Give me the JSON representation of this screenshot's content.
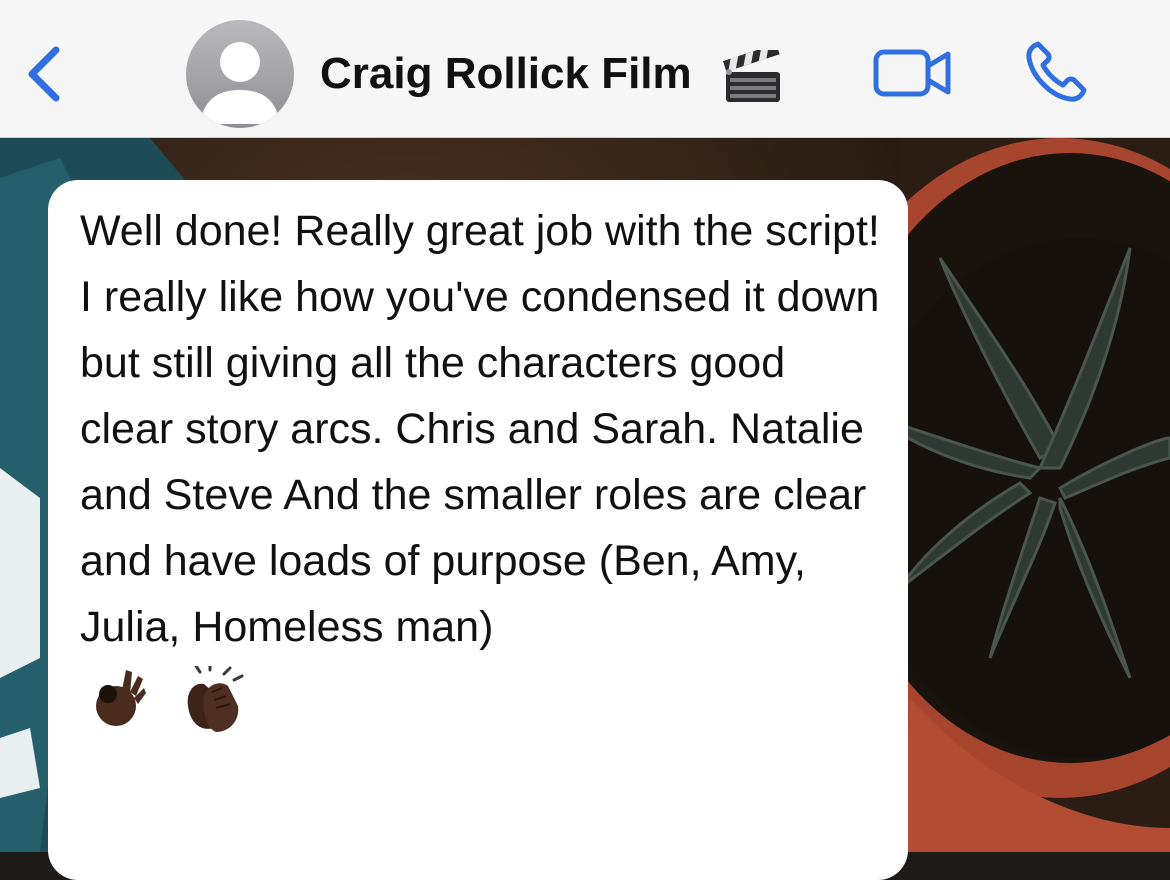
{
  "header": {
    "contact_name": "Craig Rollick Film",
    "back_icon": "chevron-left-icon",
    "avatar_icon": "person-silhouette-icon",
    "name_emoji": "clapper-board-icon",
    "video_icon": "video-camera-icon",
    "call_icon": "phone-icon"
  },
  "message": {
    "text": "Well done! Really great job with the script! I really like how you've condensed it down but still giving all the characters good clear story arcs. Chris and Sarah. Natalie and Steve And the smaller roles are clear and have loads of purpose (Ben, Amy, Julia, Homeless man)",
    "emojis": [
      "ok-hand-icon",
      "clapping-hands-icon"
    ]
  },
  "colors": {
    "accent": "#2f6fe0",
    "header_bg": "#f6f6f6",
    "bubble_bg": "#ffffff",
    "text": "#111111"
  }
}
